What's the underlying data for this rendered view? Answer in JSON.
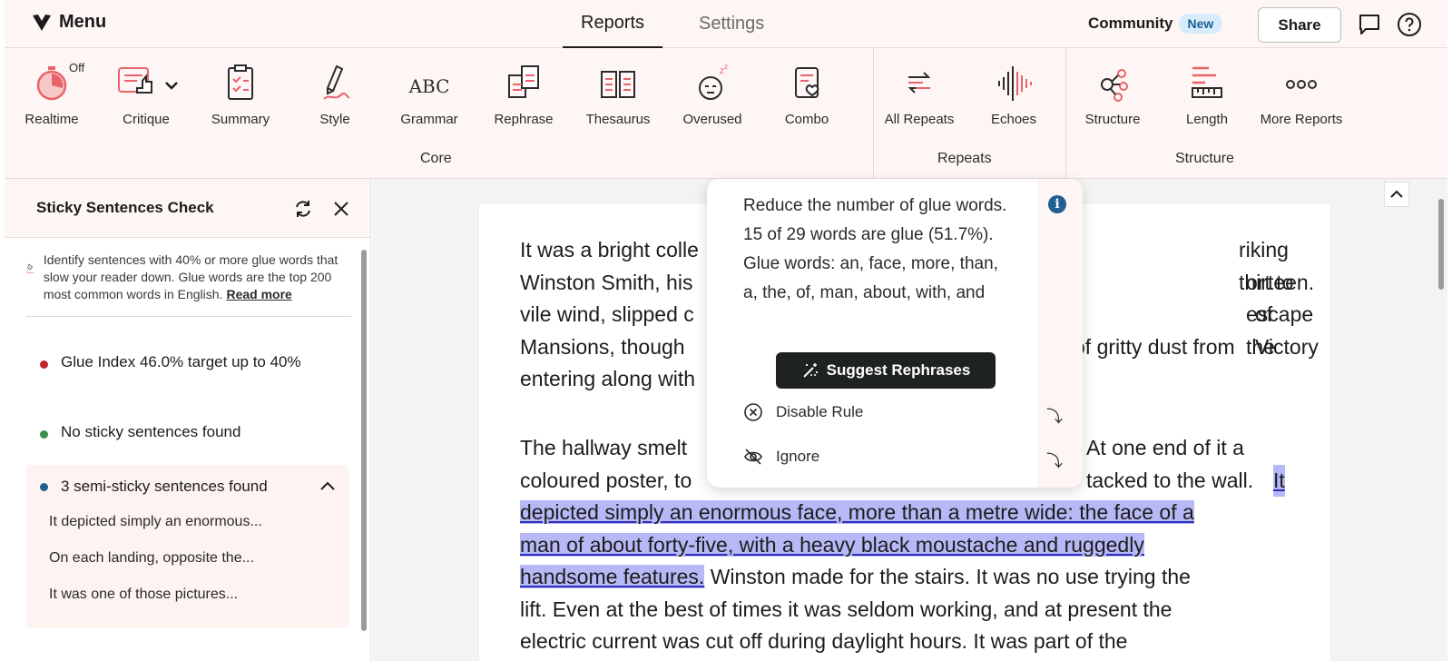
{
  "topbar": {
    "menu_label": "Menu",
    "tabs": [
      {
        "label": "Reports",
        "active": true
      },
      {
        "label": "Settings",
        "active": false
      }
    ],
    "community_label": "Community",
    "community_badge": "New",
    "share_label": "Share"
  },
  "toolbar": {
    "realtime_state": "Off",
    "core_items": [
      "Realtime",
      "Critique",
      "Summary",
      "Style",
      "Grammar",
      "Rephrase",
      "Thesaurus",
      "Overused",
      "Combo"
    ],
    "repeats_items": [
      "All Repeats",
      "Echoes"
    ],
    "structure_items": [
      "Structure",
      "Length",
      "More Reports"
    ],
    "groups": [
      "Core",
      "Repeats",
      "Structure"
    ],
    "grammar_icon_text": "ABC"
  },
  "sidebar": {
    "title": "Sticky Sentences Check",
    "info_text": "Identify sentences with 40% or more glue words that slow your reader down. Glue words are the top 200 most common words in English.",
    "read_more": "Read more",
    "items": [
      {
        "label": "Glue Index 46.0% target up to 40%",
        "color": "#c0272d"
      },
      {
        "label": "No sticky sentences found",
        "color": "#3a8f4a"
      },
      {
        "label": "3 semi-sticky sentences found",
        "color": "#1f5f92"
      }
    ],
    "semi_sentences": [
      "It depicted simply an enormous...",
      "On each landing, opposite the...",
      "It was one of those pictures..."
    ]
  },
  "editor": {
    "para1": [
      "It was a bright colle",
      "riking thirteen.",
      "Winston Smith, his",
      "ort to escape the",
      "vile wind, slipped c",
      "of Victory",
      "Mansions, though",
      "of gritty dust from",
      "entering along with"
    ],
    "para2_line1_a": "The hallway smelt",
    "para2_line1_b": "At one end of it a",
    "para2_line2_a": "coloured poster, to",
    "para2_line2_b": "tacked to the wall.",
    "highlight_1": "It",
    "highlight_2": "depicted simply an enormous face, more than a metre wide: the face of a",
    "highlight_3": "man of about forty-five, with a heavy black moustache and ruggedly",
    "highlight_4": "handsome features.",
    "after_highlight": "Winston made for the stairs. It was no use trying the",
    "line_6": "lift. Even at the best of times it was seldom working, and at present the",
    "line_7": "electric current was cut off during daylight hours. It was part of the"
  },
  "popover": {
    "message": "Reduce the number of glue words. 15 of 29 words are glue (51.7%). Glue words: an, face, more, than, a, the, of, man, about, with, and",
    "suggest_label": "Suggest Rephrases",
    "disable_label": "Disable Rule",
    "ignore_label": "Ignore"
  },
  "colors": {
    "accent_pink": "#e8636b",
    "highlight": "#b7b9f7",
    "dark_button": "#1f2320"
  }
}
